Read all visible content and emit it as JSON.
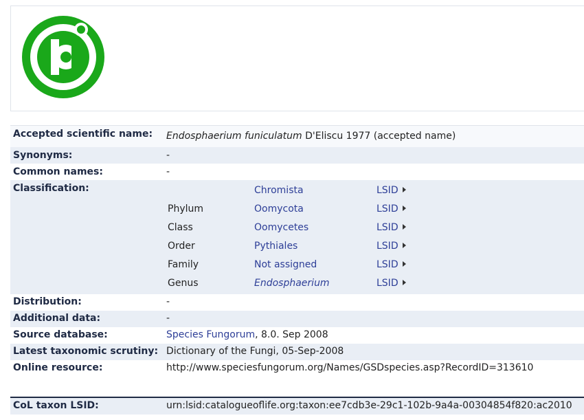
{
  "accepted": {
    "label": "Accepted scientific name:",
    "genus_species": "Endosphaerium funiculatum",
    "authority": "D'Eliscu 1977 (accepted name)"
  },
  "synonyms": {
    "label": "Synonyms:",
    "value": "-"
  },
  "common_names": {
    "label": "Common names:",
    "value": "-"
  },
  "classification": {
    "label": "Classification:",
    "rows": [
      {
        "rank": "",
        "name": "Chromista",
        "lsid": "LSID"
      },
      {
        "rank": "Phylum",
        "name": "Oomycota",
        "lsid": "LSID"
      },
      {
        "rank": "Class",
        "name": "Oomycetes",
        "lsid": "LSID"
      },
      {
        "rank": "Order",
        "name": "Pythiales",
        "lsid": "LSID"
      },
      {
        "rank": "Family",
        "name": "Not assigned",
        "lsid": "LSID"
      },
      {
        "rank": "Genus",
        "name": "Endosphaerium",
        "lsid": "LSID"
      }
    ]
  },
  "distribution": {
    "label": "Distribution:",
    "value": "-"
  },
  "additional": {
    "label": "Additional data:",
    "value": "-"
  },
  "source": {
    "label": "Source database:",
    "link": "Species Fungorum",
    "rest": ", 8.0. Sep 2008"
  },
  "scrutiny": {
    "label": "Latest taxonomic scrutiny:",
    "value": "Dictionary of the Fungi, 05-Sep-2008"
  },
  "online": {
    "label": "Online resource:",
    "value": "http://www.speciesfungorum.org/Names/GSDspecies.asp?RecordID=313610"
  },
  "col": {
    "label": "CoL taxon LSID:",
    "value": "urn:lsid:catalogueoflife.org:taxon:ee7cdb3e-29c1-102b-9a4a-00304854f820:ac2010"
  },
  "colors": {
    "logo_green": "#1aa81a",
    "link": "#2d3e97",
    "shade": "#e9eef5"
  }
}
